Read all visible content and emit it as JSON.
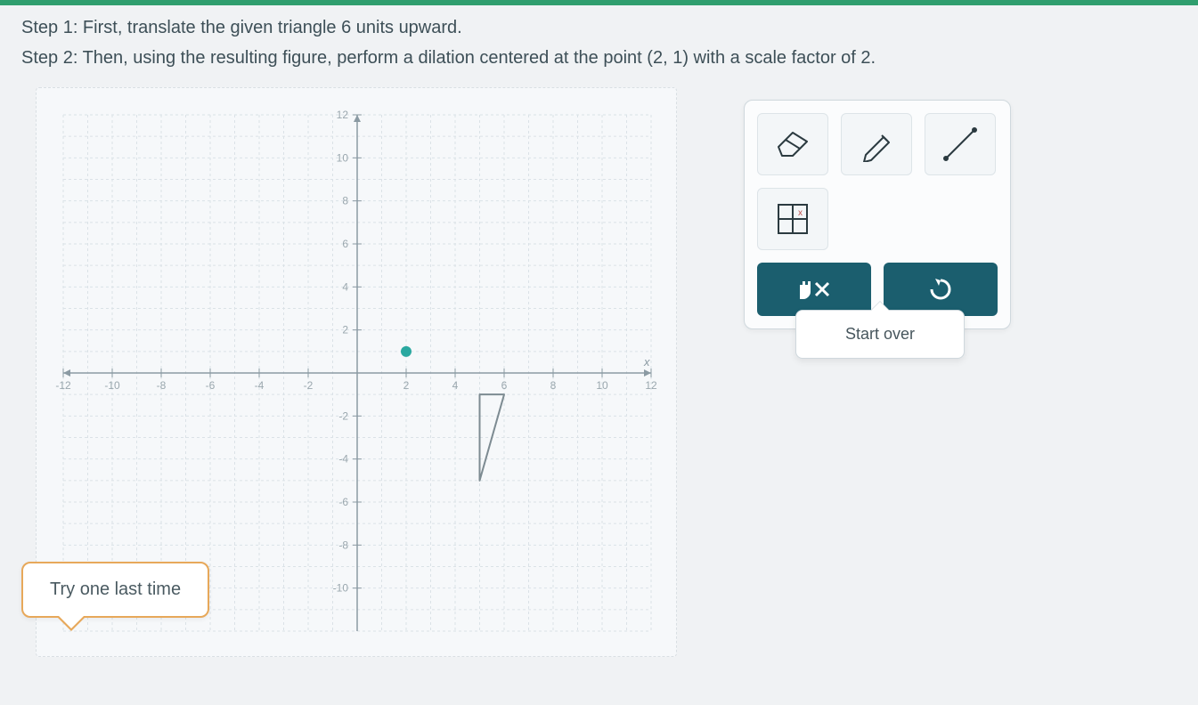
{
  "instructions": {
    "step1_prefix": "Step 1: First, translate the given triangle ",
    "step1_units": "6",
    "step1_suffix": " units upward.",
    "step2_prefix": "Step 2: Then, using the resulting figure, perform a dilation centered at the point ",
    "step2_point": "(2, 1)",
    "step2_mid": " with a scale factor of ",
    "step2_factor": "2",
    "step2_suffix": "."
  },
  "tooltip": {
    "text": "Start over"
  },
  "hint": {
    "text": "Try one last time"
  },
  "tools": {
    "eraser": "Eraser",
    "pencil": "Pencil",
    "line": "Line segment",
    "point_grid": "Plot point",
    "clear": "Clear",
    "undo": "Undo"
  },
  "chart_data": {
    "type": "scatter",
    "title": "",
    "xlabel": "x",
    "ylabel": "",
    "xlim": [
      -12,
      12
    ],
    "ylim": [
      -12,
      12
    ],
    "x_ticks": [
      -12,
      -10,
      -8,
      -6,
      -4,
      -2,
      2,
      4,
      6,
      8,
      10,
      12
    ],
    "y_ticks": [
      -10,
      -8,
      -6,
      -4,
      -2,
      2,
      4,
      6,
      8,
      10,
      12
    ],
    "grid": true,
    "series": [
      {
        "name": "center-of-dilation",
        "type": "point",
        "x": [
          2
        ],
        "y": [
          1
        ],
        "color": "#2aa8a0"
      },
      {
        "name": "given-triangle",
        "type": "polygon",
        "points": [
          [
            5,
            -1
          ],
          [
            5,
            -5
          ],
          [
            6,
            -1
          ]
        ],
        "stroke": "#7d8b92",
        "fill": "none"
      }
    ]
  }
}
